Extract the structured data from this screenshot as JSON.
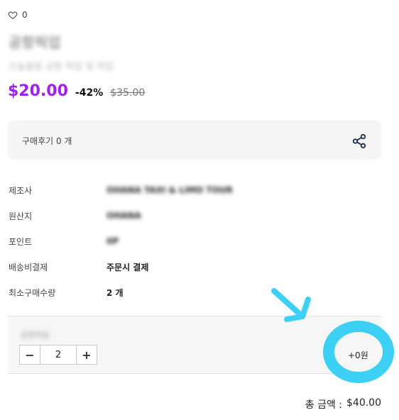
{
  "likes": {
    "count": "0"
  },
  "product": {
    "title": "공항픽업",
    "subtitle": "오늘출발 공항 픽업 및 픽업",
    "price": "$20.00",
    "discount": "-42%",
    "original_price": "$35.00"
  },
  "review": {
    "label": "구매후기 0 개"
  },
  "info": [
    {
      "label": "제조사",
      "value": "OHANA TAXI & LIMO TOUR"
    },
    {
      "label": "원산지",
      "value": "OHANA"
    },
    {
      "label": "포인트",
      "value": "0P"
    },
    {
      "label": "배송비결제",
      "value": "주문시 결제"
    },
    {
      "label": "최소구매수량",
      "value": "2 개"
    }
  ],
  "option": {
    "name": "공항픽업",
    "minus": "−",
    "quantity": "2",
    "plus": "+",
    "price": "+0원"
  },
  "total": {
    "label": "총 금액 :",
    "value": "$40.00"
  },
  "colors": {
    "accent": "#a020f0",
    "annotation": "#3dd0f5"
  }
}
